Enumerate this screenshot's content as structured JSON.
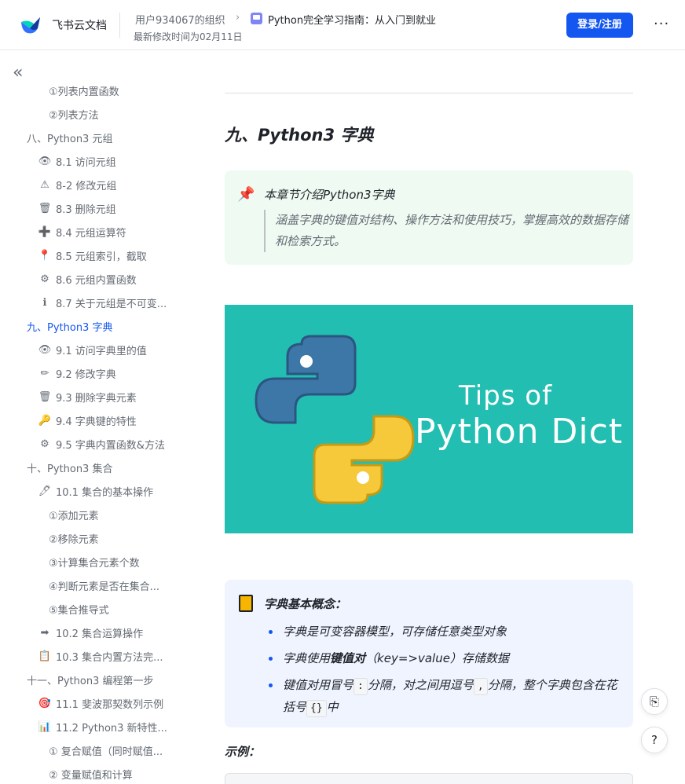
{
  "header": {
    "brand": "飞书云文档",
    "org": "用户934067的组织",
    "chevron": "›",
    "doc_title": "Python完全学习指南：从入门到就业",
    "modified": "最新修改时间为02月11日",
    "login_label": "登录/注册",
    "more_label": "···"
  },
  "sidebar": {
    "collapse_label": "«",
    "items": [
      {
        "text": "①列表内置函数",
        "icon": "",
        "indent": 2
      },
      {
        "text": "②列表方法",
        "icon": "",
        "indent": 2
      },
      {
        "text": "八、Python3 元组",
        "icon": "",
        "indent": 0
      },
      {
        "text": "8.1 访问元组",
        "icon": "👁",
        "indent": 1
      },
      {
        "text": "8-2 修改元组",
        "icon": "⚠",
        "indent": 1
      },
      {
        "text": "8.3 删除元组",
        "icon": "🗑",
        "indent": 1
      },
      {
        "text": "8.4 元组运算符",
        "icon": "➕",
        "indent": 1
      },
      {
        "text": "8.5 元组索引，截取",
        "icon": "📍",
        "indent": 1
      },
      {
        "text": "8.6 元组内置函数",
        "icon": "⚙",
        "indent": 1
      },
      {
        "text": "8.7 关于元组是不可变...",
        "icon": "ℹ",
        "indent": 1
      },
      {
        "text": "九、Python3 字典",
        "icon": "",
        "indent": 0,
        "active": true
      },
      {
        "text": "9.1 访问字典里的值",
        "icon": "👁",
        "indent": 1
      },
      {
        "text": "9.2 修改字典",
        "icon": "✏",
        "indent": 1
      },
      {
        "text": "9.3 删除字典元素",
        "icon": "🗑",
        "indent": 1
      },
      {
        "text": "9.4 字典键的特性",
        "icon": "🔑",
        "indent": 1
      },
      {
        "text": "9.5 字典内置函数&方法",
        "icon": "⚙",
        "indent": 1
      },
      {
        "text": "十、Python3 集合",
        "icon": "",
        "indent": 0
      },
      {
        "text": "10.1 集合的基本操作",
        "icon": "🖊",
        "indent": 1
      },
      {
        "text": "①添加元素",
        "icon": "",
        "indent": 2
      },
      {
        "text": "②移除元素",
        "icon": "",
        "indent": 2
      },
      {
        "text": "③计算集合元素个数",
        "icon": "",
        "indent": 2
      },
      {
        "text": "④判断元素是否在集合...",
        "icon": "",
        "indent": 2
      },
      {
        "text": "⑤集合推导式",
        "icon": "",
        "indent": 2
      },
      {
        "text": "10.2 集合运算操作",
        "icon": "➡",
        "indent": 1
      },
      {
        "text": "10.3 集合内置方法完...",
        "icon": "📋",
        "indent": 1
      },
      {
        "text": "十一、Python3 编程第一步",
        "icon": "",
        "indent": 0
      },
      {
        "text": "11.1 斐波那契数列示例",
        "icon": "🎯",
        "indent": 1
      },
      {
        "text": "11.2 Python3 新特性...",
        "icon": "📊",
        "indent": 1
      },
      {
        "text": "① 复合赋值（同时赋值...",
        "icon": "",
        "indent": 2
      },
      {
        "text": "② 变量赋值和计算",
        "icon": "",
        "indent": 2
      }
    ]
  },
  "main": {
    "heading": "九、Python3 字典",
    "intro_callout": {
      "icon": "pushpin-icon",
      "title": "本章节介绍Python3字典",
      "quote": "涵盖字典的键值对结构、操作方法和使用技巧，掌握高效的数据存储和检索方式。"
    },
    "banner": {
      "line1": "Tips of",
      "line2": "Python Dict",
      "bg_color": "#23beb2"
    },
    "concept_callout": {
      "icon": "book-icon",
      "title": "字典基本概念：",
      "bullet1": "字典是可变容器模型，可存储任意类型对象",
      "bullet2_pre": "字典使用",
      "bullet2_bold": "键值对",
      "bullet2_post": "（key=>value）存储数据",
      "bullet3_pre": "键值对用冒号",
      "bullet3_code1": ":",
      "bullet3_mid": "分隔，对之间用逗号",
      "bullet3_code2": ",",
      "bullet3_mid2": "分隔，整个字典包含在花括号",
      "bullet3_code3": "{}",
      "bullet3_post": "中"
    },
    "example_label": "示例："
  },
  "floating": {
    "outline_icon": "outline-icon",
    "help_label": "?"
  },
  "colors": {
    "accent": "#1456f0",
    "green_callout": "#effaf2",
    "blue_callout": "#f0f4ff"
  }
}
